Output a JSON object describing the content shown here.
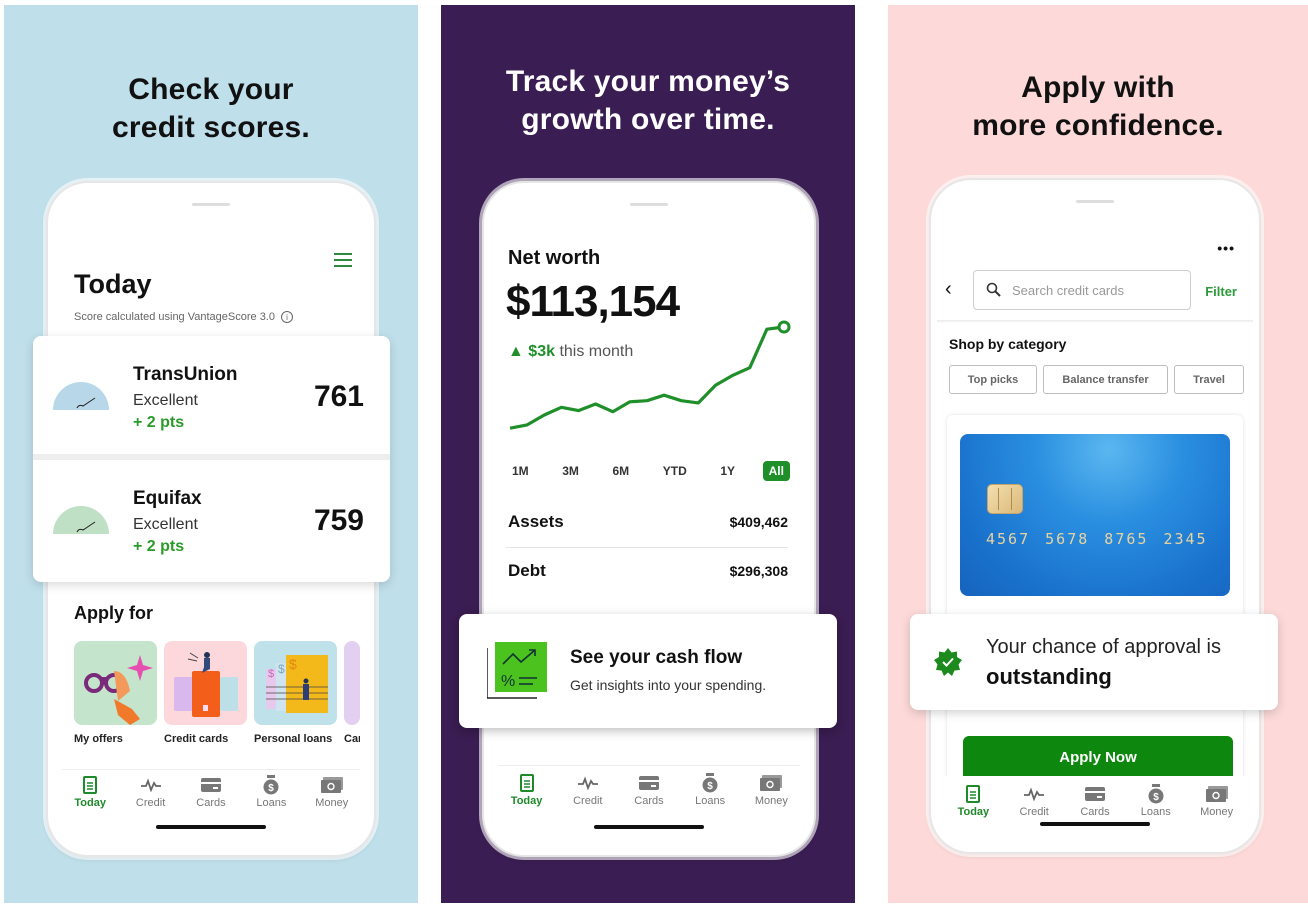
{
  "colors": {
    "panel1_bg": "#bfdfea",
    "panel2_bg": "#3a1d52",
    "panel3_bg": "#fddad9",
    "brand_green": "#1f8f2a",
    "apply_button": "#0d870d"
  },
  "nav": {
    "items": [
      {
        "label": "Today",
        "icon": "today-icon",
        "active": true
      },
      {
        "label": "Credit",
        "icon": "pulse-icon",
        "active": false
      },
      {
        "label": "Cards",
        "icon": "card-icon",
        "active": false
      },
      {
        "label": "Loans",
        "icon": "money-bag-icon",
        "active": false
      },
      {
        "label": "Money",
        "icon": "cash-icon",
        "active": false
      }
    ]
  },
  "panel1": {
    "headline_line1": "Check your",
    "headline_line2": "credit scores.",
    "title": "Today",
    "subtitle": "Score calculated using VantageScore 3.0",
    "scores": [
      {
        "bureau": "TransUnion",
        "rating": "Excellent",
        "change": "+ 2 pts",
        "score": "761",
        "gauge_color": "#b8d8ea"
      },
      {
        "bureau": "Equifax",
        "rating": "Excellent",
        "change": "+ 2 pts",
        "score": "759",
        "gauge_color": "#bfe0c4"
      }
    ],
    "apply_title": "Apply for",
    "tiles": [
      {
        "label": "My offers"
      },
      {
        "label": "Credit cards"
      },
      {
        "label": "Personal loans"
      },
      {
        "label": "Car"
      }
    ]
  },
  "panel2": {
    "headline_line1": "Track your money’s",
    "headline_line2": "growth over time.",
    "net_worth_label": "Net worth",
    "net_worth_value": "$113,154",
    "change_arrow": "▲",
    "change_amount": "$3k",
    "change_period": "this month",
    "ranges": [
      {
        "label": "1M",
        "active": false
      },
      {
        "label": "3M",
        "active": false
      },
      {
        "label": "6M",
        "active": false
      },
      {
        "label": "YTD",
        "active": false
      },
      {
        "label": "1Y",
        "active": false
      },
      {
        "label": "All",
        "active": true
      }
    ],
    "assets_label": "Assets",
    "assets_value": "$409,462",
    "debt_label": "Debt",
    "debt_value": "$296,308",
    "cash_flow_title": "See your cash flow",
    "cash_flow_sub": "Get insights into your spending."
  },
  "chart_data": {
    "type": "line",
    "title": "Net worth",
    "xlabel": "",
    "ylabel": "",
    "grid": false,
    "note": "relative net worth trend (unlabeled axes), normalized 0-100",
    "x": [
      0,
      1,
      2,
      3,
      4,
      5,
      6,
      7,
      8,
      9,
      10,
      11,
      12,
      13,
      14,
      15,
      16
    ],
    "series": [
      {
        "name": "Net worth",
        "values": [
          8,
          11,
          20,
          27,
          24,
          30,
          23,
          32,
          33,
          38,
          33,
          31,
          47,
          56,
          63,
          98,
          100
        ]
      }
    ],
    "ylim": [
      0,
      100
    ]
  },
  "panel3": {
    "headline_line1": "Apply with",
    "headline_line2": "more confidence.",
    "more_label": "•••",
    "back_label": "‹",
    "search_placeholder": "Search credit cards",
    "filter_label": "Filter",
    "shop_title": "Shop by category",
    "chips": [
      "Top picks",
      "Balance transfer",
      "Travel"
    ],
    "card_number": "4567 5678 8765 2345",
    "approval_line1": "Your chance of approval is",
    "approval_line2": "outstanding",
    "apply_button": "Apply Now"
  }
}
